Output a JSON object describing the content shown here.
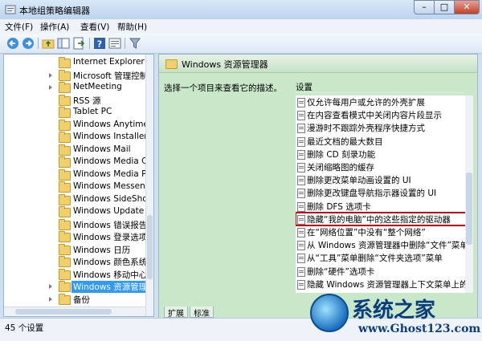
{
  "window": {
    "title": "本地组策略编辑器",
    "caption_min": "–",
    "caption_max": "□",
    "caption_close": "✕"
  },
  "menubar": {
    "items": [
      "文件(F)",
      "操作(A)",
      "查看(V)",
      "帮助(H)"
    ]
  },
  "toolbar": {
    "icons": [
      "back-arrow-icon",
      "forward-arrow-icon",
      "up-folder-icon",
      "show-tree-icon",
      "export-icon",
      "help-icon",
      "properties-icon",
      "filter-icon"
    ]
  },
  "tree": {
    "items": [
      "Internet Explorer",
      "Microsoft 管理控制台",
      "NetMeeting",
      "RSS 源",
      "Tablet PC",
      "Windows Anytime Up",
      "Windows Installer",
      "Windows Mail",
      "Windows Media Cent",
      "Windows Media Play",
      "Windows Messenger",
      "Windows SideShow",
      "Windows Update",
      "Windows 错误报告",
      "Windows 登录选项",
      "Windows 日历",
      "Windows 颜色系统",
      "Windows 移动中心",
      "Windows 资源管理器",
      "备份"
    ],
    "selected_index": 18
  },
  "right": {
    "header_title": "Windows 资源管理器",
    "description": "选择一个项目来查看它的描述。",
    "settings_header": "设置",
    "settings": [
      "仅允许每用户或允许的外壳扩展",
      "在内容查看模式中关闭内容片段显示",
      "漫游时不跟踪外壳程序快捷方式",
      "最近文档的最大数目",
      "删除 CD 刻录功能",
      "关闭缩略图的缓存",
      "删除更改菜单动画设置的 UI",
      "删除更改键盘导航指示器设置的 UI",
      "删除 DFS 选项卡",
      "隐藏“我的电脑”中的这些指定的驱动器",
      "在“网络位置”中没有“整个网络”",
      "从 Windows 资源管理器中删除“文件”菜单",
      "从“工具”菜单删除“文件夹选项”菜单",
      "删除“硬件”选项卡",
      "隐藏 Windows 资源管理器上下文菜单上的“管"
    ],
    "highlight_index": 9,
    "tabs": [
      "扩展",
      "标准"
    ]
  },
  "status": {
    "text": "45 个设置"
  },
  "watermark": {
    "brand": "系统之家",
    "url": "www.Ghost123.com"
  }
}
